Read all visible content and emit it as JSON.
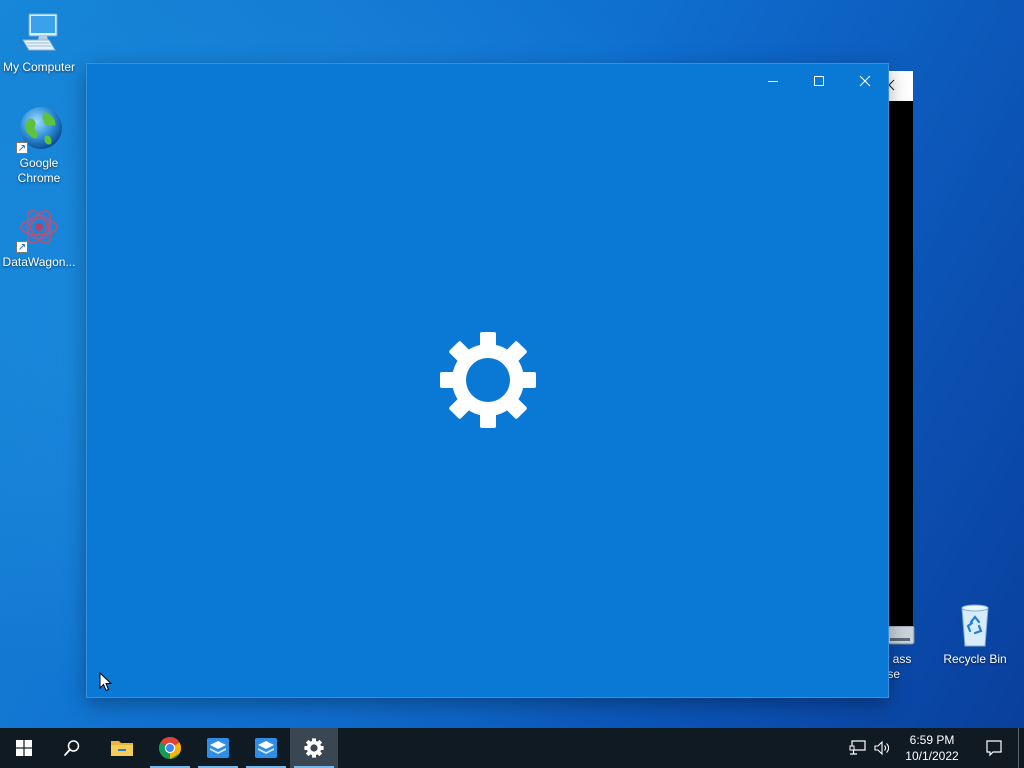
{
  "desktop": {
    "icons": [
      {
        "label": "My Computer",
        "icon": "computer-icon"
      },
      {
        "label": "Google Chrome",
        "icon": "globe-icon"
      },
      {
        "label": "DataWagon...",
        "icon": "datawagon-icon"
      },
      {
        "label": "Recycle Bin",
        "icon": "recycle-bin-icon"
      }
    ],
    "partial_icon_label": "ply ass\nouse"
  },
  "settings_window": {
    "background_color": "#0a78d5",
    "splash_icon": "gear-icon",
    "controls": {
      "minimize": "minimize-icon",
      "maximize": "maximize-icon",
      "close": "close-icon"
    }
  },
  "taskbar": {
    "buttons": [
      {
        "name": "start",
        "icon": "windows-logo-icon"
      },
      {
        "name": "search",
        "icon": "search-icon"
      },
      {
        "name": "file-explorer",
        "icon": "folder-icon"
      },
      {
        "name": "chrome",
        "icon": "chrome-icon"
      },
      {
        "name": "app-1",
        "icon": "app-box-icon"
      },
      {
        "name": "app-2",
        "icon": "app-box-icon"
      },
      {
        "name": "settings",
        "icon": "gear-icon",
        "active": true
      }
    ],
    "tray": {
      "network_icon": "network-icon",
      "volume_icon": "volume-icon",
      "time": "6:59 PM",
      "date": "10/1/2022",
      "notification_icon": "notification-icon"
    }
  },
  "colors": {
    "taskbar": "#101a23",
    "accent": "#76b9ed",
    "window": "#0a78d5"
  }
}
